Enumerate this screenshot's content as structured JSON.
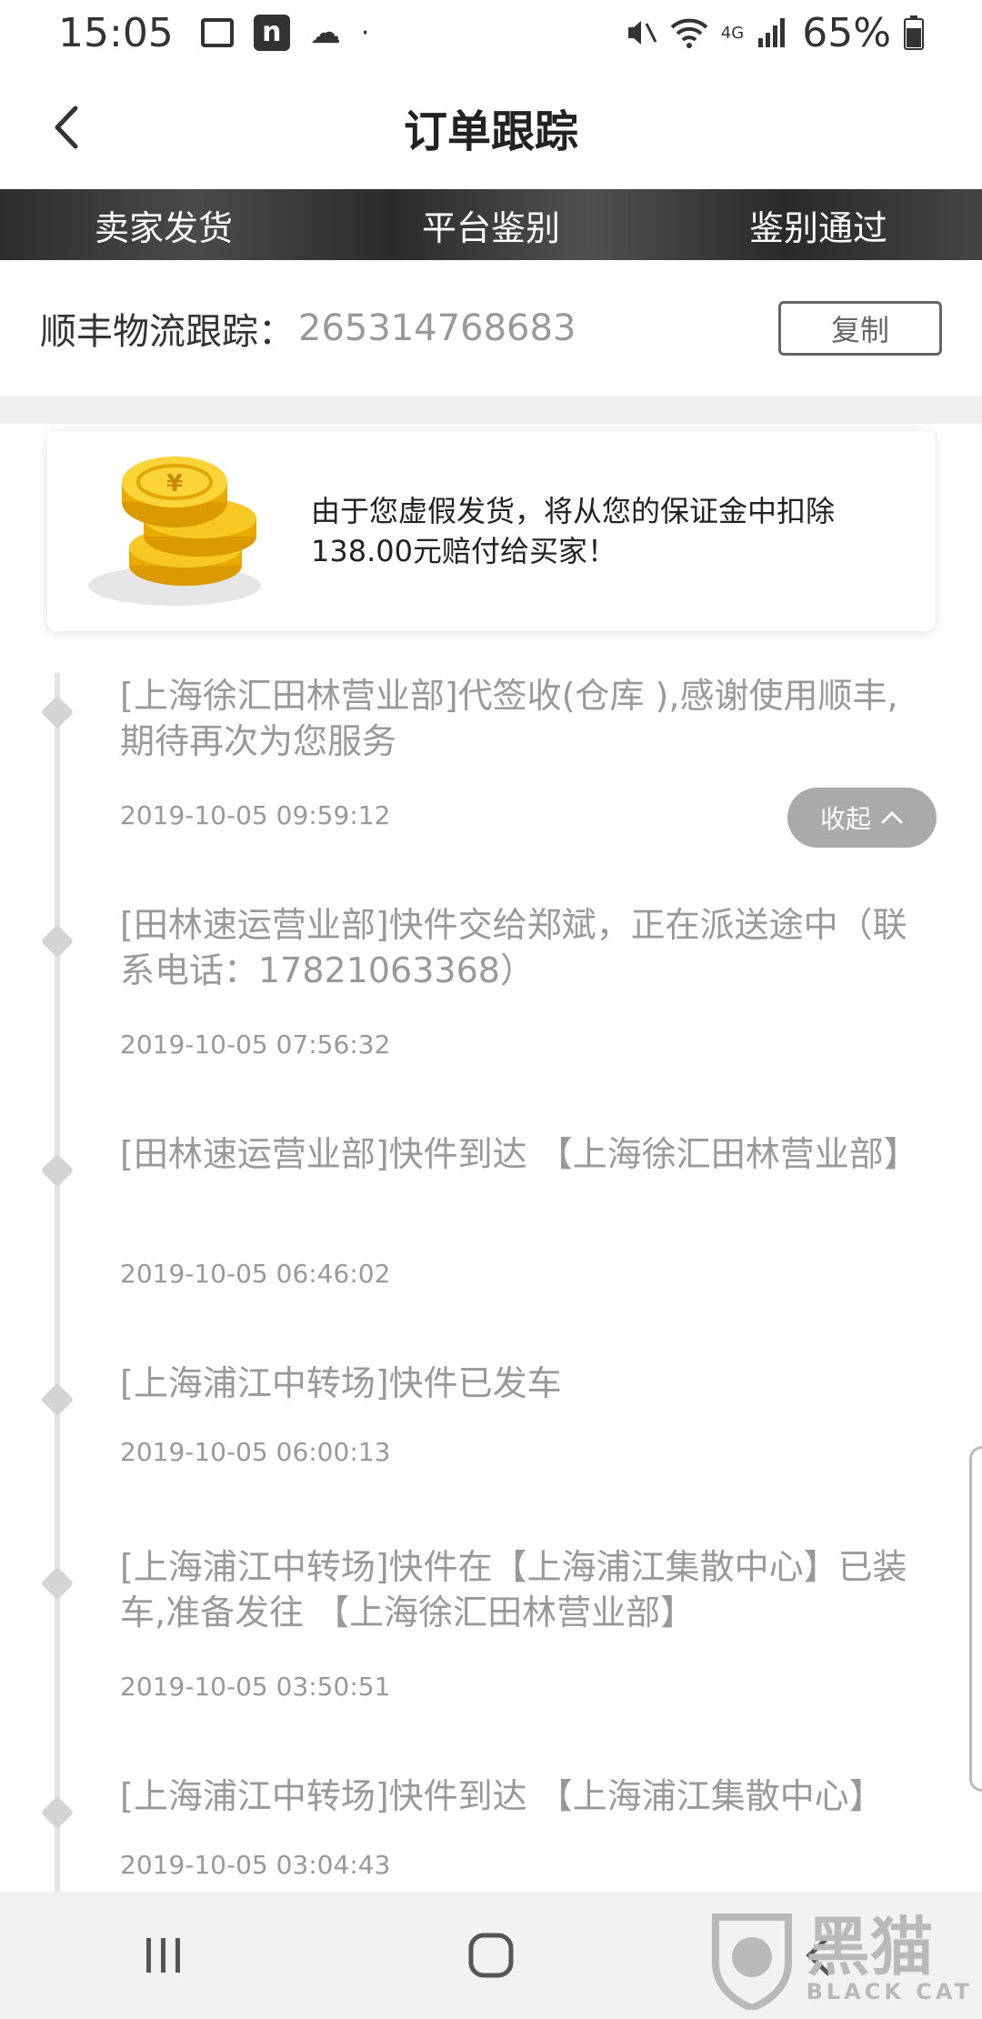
{
  "status_bar": {
    "time": "15:05",
    "battery": "65%",
    "network": "4G"
  },
  "nav": {
    "title": "订单跟踪"
  },
  "steps": [
    "卖家发货",
    "平台鉴别",
    "鉴别通过"
  ],
  "logistics": {
    "label": "顺丰物流跟踪：",
    "tracking_number": "265314768683",
    "copy_label": "复制"
  },
  "notice": {
    "line1": "由于您虚假发货，将从您的保证金中扣除",
    "line2": "138.00元赔付给买家！"
  },
  "timeline": [
    {
      "text": "[上海徐汇田林营业部]代签收(仓库 ),感谢使用顺丰,期待再次为您服务",
      "time": "2019-10-05 09:59:12"
    },
    {
      "text": "[田林速运营业部]快件交给郑斌，正在派送途中（联系电话：17821063368）",
      "time": "2019-10-05 07:56:32"
    },
    {
      "text": "[田林速运营业部]快件到达 【上海徐汇田林营业部】",
      "time": "2019-10-05 06:46:02"
    },
    {
      "text": "[上海浦江中转场]快件已发车",
      "time": "2019-10-05 06:00:13"
    },
    {
      "text": "[上海浦江中转场]快件在【上海浦江集散中心】已装车,准备发往 【上海徐汇田林营业部】",
      "time": "2019-10-05 03:50:51"
    },
    {
      "text": "[上海浦江中转场]快件到达 【上海浦江集散中心】",
      "time": "2019-10-05 03:04:43"
    }
  ],
  "collapse_label": "收起",
  "watermark": {
    "title": "黑猫",
    "subtitle": "BLACK CAT"
  },
  "colors": {
    "banner": "#333333",
    "collapse_btn": "#aaaaaa",
    "timeline_text": "#999999"
  }
}
